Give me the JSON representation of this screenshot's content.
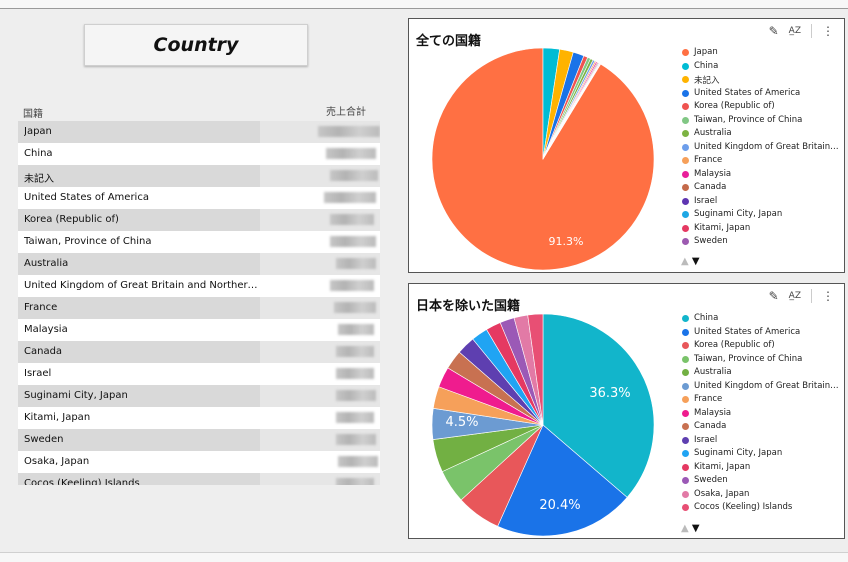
{
  "report": {
    "title": "Country"
  },
  "table": {
    "headers": [
      "国籍",
      "売上合計"
    ],
    "rows": [
      "Japan",
      "China",
      "未記入",
      "United States of America",
      "Korea (Republic of)",
      "Taiwan, Province of China",
      "Australia",
      "United Kingdom of Great Britain and Northern Irela…",
      "France",
      "Malaysia",
      "Canada",
      "Israel",
      "Suginami City, Japan",
      "Kitami, Japan",
      "Sweden",
      "Osaka, Japan",
      "Cocos (Keeling) Islands"
    ]
  },
  "toolbar": {
    "edit_icon": "pencil-icon",
    "sort_icon": "sort-az-icon",
    "menu_icon": "more-vert-icon"
  },
  "chart_data": [
    {
      "type": "pie",
      "title": "全ての国籍",
      "labels": [
        "Japan",
        "China",
        "未記入",
        "United States of America",
        "Korea (Republic of)",
        "Taiwan, Province of China",
        "Australia",
        "United Kingdom of Great Britain…",
        "France",
        "Malaysia",
        "Canada",
        "Israel",
        "Suginami City, Japan",
        "Kitami, Japan",
        "Sweden"
      ],
      "values": [
        91.3,
        2.4,
        2.0,
        1.6,
        0.6,
        0.45,
        0.4,
        0.3,
        0.2,
        0.2,
        0.15,
        0.12,
        0.1,
        0.09,
        0.08
      ],
      "colors": [
        "#ff7043",
        "#00bcd4",
        "#ffb300",
        "#1a73e8",
        "#ef5350",
        "#81c784",
        "#7cb342",
        "#6d9eeb",
        "#f6a05a",
        "#e91e9a",
        "#c46a4a",
        "#5e35b1",
        "#1ea7e4",
        "#e53962",
        "#9c5ab0"
      ],
      "data_labels": [
        "91.3%"
      ],
      "legend_position": "right",
      "legend_pager": [
        "▲",
        "▼"
      ]
    },
    {
      "type": "pie",
      "title": "日本を除いた国籍",
      "labels": [
        "China",
        "United States of America",
        "Korea (Republic of)",
        "Taiwan, Province of China",
        "Australia",
        "United Kingdom of Great Britain…",
        "France",
        "Malaysia",
        "Canada",
        "Israel",
        "Suginami City, Japan",
        "Kitami, Japan",
        "Sweden",
        "Osaka, Japan",
        "Cocos (Keeling) Islands"
      ],
      "values": [
        36.3,
        20.4,
        6.5,
        4.9,
        4.8,
        4.5,
        3.2,
        3.0,
        2.8,
        2.7,
        2.4,
        2.2,
        2.1,
        2.0,
        2.2
      ],
      "colors": [
        "#12b5cb",
        "#1a73e8",
        "#e8575a",
        "#7ac36a",
        "#72b043",
        "#6c9bd2",
        "#f6a05a",
        "#ef1c8e",
        "#c87151",
        "#5e3fb0",
        "#20a4f3",
        "#e53962",
        "#9b59b6",
        "#e27aa6",
        "#e84f74"
      ],
      "data_labels": [
        "36.3%",
        "20.4%",
        "4.5%"
      ],
      "legend_position": "right",
      "legend_pager": [
        "▲",
        "▼"
      ]
    }
  ]
}
